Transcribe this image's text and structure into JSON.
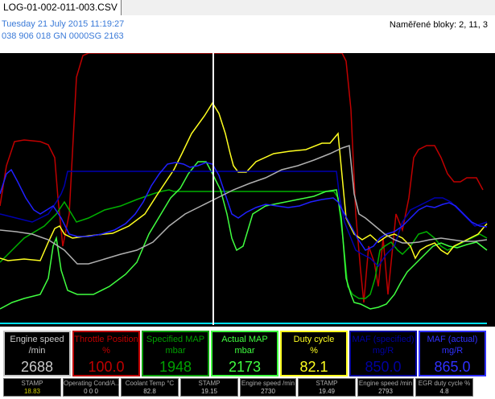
{
  "tab": {
    "filename": "LOG-01-002-011-003.CSV"
  },
  "header": {
    "date": "Tuesday 21 July 2015 11:19:27",
    "ecu": "038 906 018 GN  0000SG  2163",
    "blocks": "Naměřené bloky: 2, 11, 3"
  },
  "colors": {
    "engine_speed": "#b0b0b0",
    "throttle": "#c00000",
    "specified_map": "#00b000",
    "actual_map": "#40ff40",
    "duty_cycle": "#ffff20",
    "maf_specified": "#0000b0",
    "maf_actual": "#2020ff",
    "cursor": "#ffffff",
    "baseline": "#00e0ff"
  },
  "gauges": [
    {
      "name": "Engine speed",
      "unit": "/min",
      "value": "2688",
      "color": "#c8c8c8"
    },
    {
      "name": "Throttle Position",
      "unit": "%",
      "value": "100.0",
      "color": "#c00000"
    },
    {
      "name": "Specified MAP",
      "unit": "mbar",
      "value": "1948",
      "color": "#00a000"
    },
    {
      "name": "Actual MAP",
      "unit": "mbar",
      "value": "2173",
      "color": "#40ff40"
    },
    {
      "name": "Duty cycle",
      "unit": "%",
      "value": "82.1",
      "color": "#ffff20"
    },
    {
      "name": "MAF (specified)",
      "unit": "mg/R",
      "value": "850.0",
      "color": "#0000a0"
    },
    {
      "name": "MAF (actual)",
      "unit": "mg/R",
      "value": "865.0",
      "color": "#3030ff"
    }
  ],
  "stats": [
    {
      "name": "STAMP",
      "value": "18.83",
      "color": "#d0d000"
    },
    {
      "name": "Operating Cond/A...",
      "value": "0  0  0"
    },
    {
      "name": "Coolant Temp °C",
      "value": "82.8"
    },
    {
      "name": "STAMP",
      "value": "19.15"
    },
    {
      "name": "Engine speed /min",
      "value": "2730"
    },
    {
      "name": "STAMP",
      "value": "19.49"
    },
    {
      "name": "Engine speed /min",
      "value": "2793"
    },
    {
      "name": "EGR duty cycle %",
      "value": "4.8"
    }
  ]
}
